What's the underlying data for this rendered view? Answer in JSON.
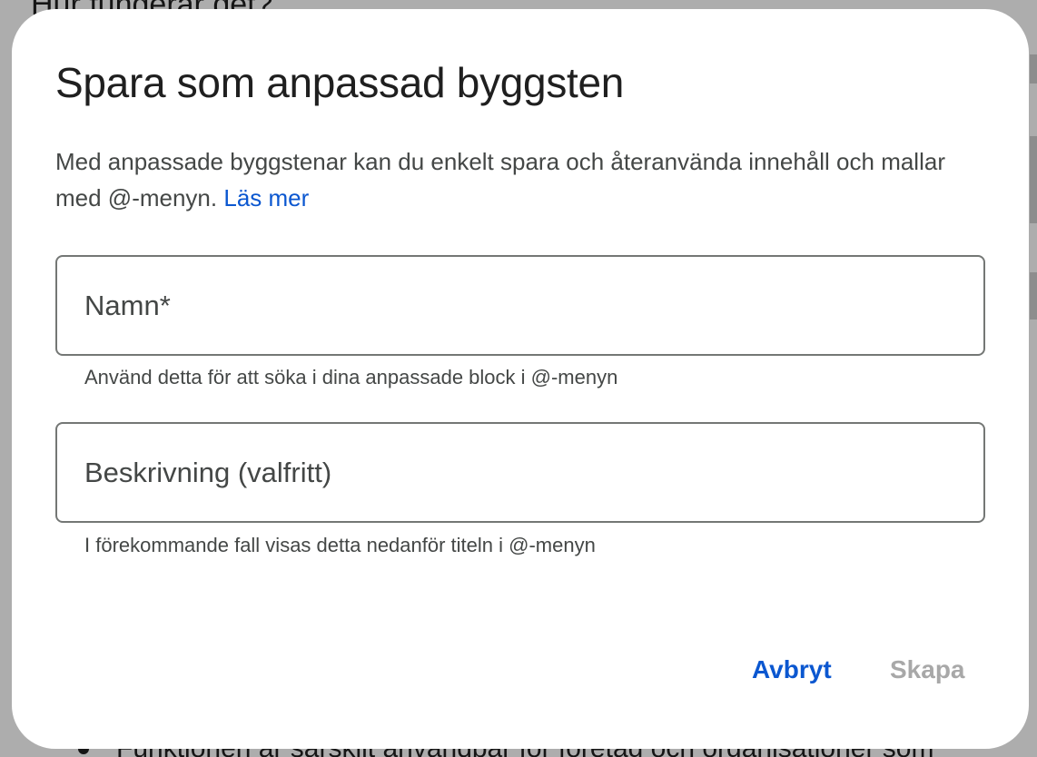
{
  "background": {
    "top_text": "Hur fungerar det?",
    "bullet_text": "Funktionen är särskilt användbar för företag och organisationer som"
  },
  "dialog": {
    "title": "Spara som anpassad byggsten",
    "description": "Med anpassade byggstenar kan du enkelt spara och återanvända innehåll och mallar med @-menyn.",
    "learn_more": "Läs mer",
    "name_field": {
      "placeholder": "Namn*",
      "value": "",
      "helper": "Använd detta för att söka i dina anpassade block i @-menyn"
    },
    "description_field": {
      "placeholder": "Beskrivning (valfritt)",
      "value": "",
      "helper": "I förekommande fall visas detta nedanför titeln i @-menyn"
    },
    "buttons": {
      "cancel": "Avbryt",
      "create": "Skapa"
    }
  },
  "colors": {
    "accent": "#0b57d0",
    "disabled": "#a8a8a8",
    "text": "#1f1f1f",
    "secondary_text": "#444746",
    "field_border": "#747775"
  }
}
